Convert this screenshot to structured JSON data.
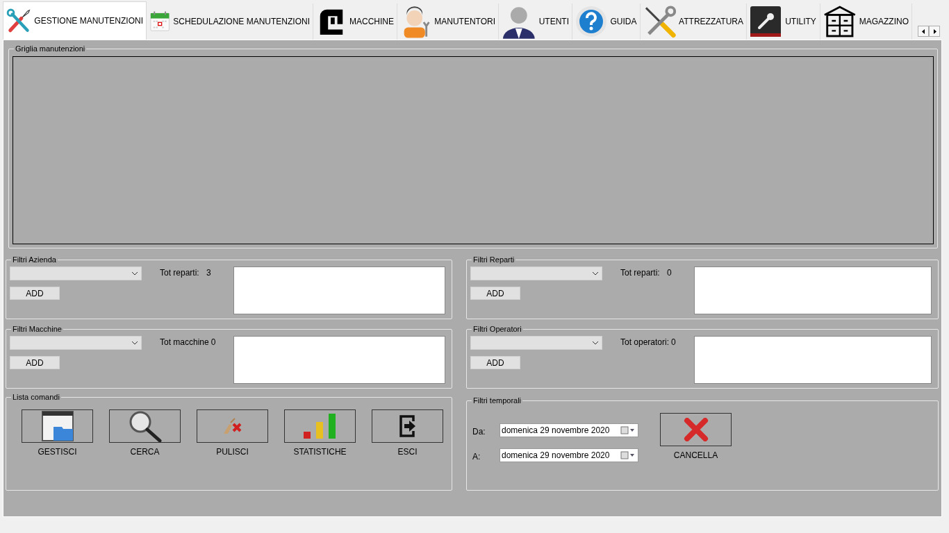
{
  "tabs": [
    {
      "label": "GESTIONE MANUTENZIONI",
      "selected": true
    },
    {
      "label": "SCHEDULAZIONE MANUTENZIONI",
      "selected": false
    },
    {
      "label": "MACCHINE",
      "selected": false
    },
    {
      "label": "MANUTENTORI",
      "selected": false
    },
    {
      "label": "UTENTI",
      "selected": false
    },
    {
      "label": "GUIDA",
      "selected": false
    },
    {
      "label": "ATTREZZATURA",
      "selected": false
    },
    {
      "label": "UTILITY",
      "selected": false
    },
    {
      "label": "MAGAZZINO",
      "selected": false
    }
  ],
  "grid_group": {
    "title": "Griglia manutenzioni"
  },
  "filter_groups": [
    {
      "title": "Filtri Azienda",
      "add_button": "ADD",
      "total_label": "Tot reparti:",
      "total_value": "3"
    },
    {
      "title": "Filtri Reparti",
      "add_button": "ADD",
      "total_label": "Tot reparti:",
      "total_value": "0"
    },
    {
      "title": "Filtri Macchine",
      "add_button": "ADD",
      "total_label": "Tot macchine",
      "total_value": "0"
    },
    {
      "title": "Filtri Operatori",
      "add_button": "ADD",
      "total_label": "Tot operatori:",
      "total_value": "0"
    }
  ],
  "commands_group": {
    "title": "Lista comandi",
    "commands": [
      "GESTISCI",
      "CERCA",
      "PULISCI",
      "STATISTICHE",
      "ESCI"
    ]
  },
  "time_filters": {
    "title": "Filtri temporali",
    "dates": [
      {
        "label": "Da:",
        "value": "domenica 29 novembre 2020"
      },
      {
        "label": "A:",
        "value": "domenica 29 novembre 2020"
      }
    ],
    "cancel_button": "CANCELLA"
  }
}
